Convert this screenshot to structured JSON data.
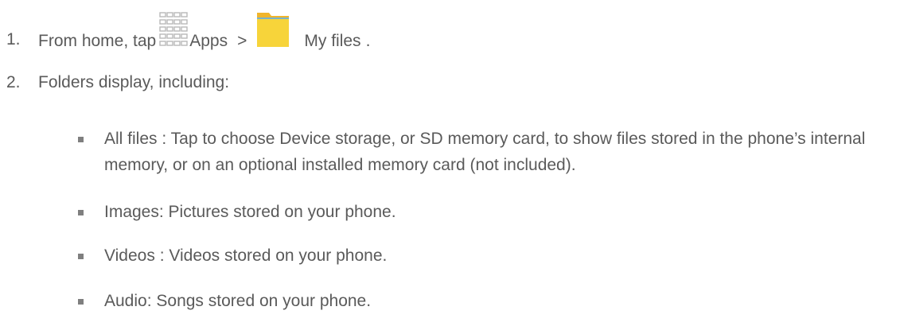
{
  "steps": [
    {
      "number": "1.",
      "text_before": "From home, tap",
      "apps_label": "Apps",
      "separator": ">",
      "my_files_label": "My files",
      "period": "."
    },
    {
      "number": "2.",
      "text": "Folders display, including:"
    }
  ],
  "bullets": [
    {
      "name": "All files",
      "desc": ": Tap to choose Device storage, or SD memory card, to show files stored in the phone’s internal memory, or on an optional installed memory card (not included)."
    },
    {
      "name": "Images",
      "desc": ": Pictures stored on your phone."
    },
    {
      "name": "Videos",
      "desc": ": Videos stored on your phone."
    },
    {
      "name": "Audio",
      "desc": ": Songs stored on your phone."
    }
  ],
  "icons": {
    "apps": "apps-grid-icon",
    "my_files": "folder-icon"
  },
  "colors": {
    "text": "#5a5a5a",
    "bullet_marker": "#7f7f7f",
    "folder_yellow": "#f7d43a",
    "folder_tab": "#f0b52c",
    "apps_grid": "#b8b8b8"
  }
}
